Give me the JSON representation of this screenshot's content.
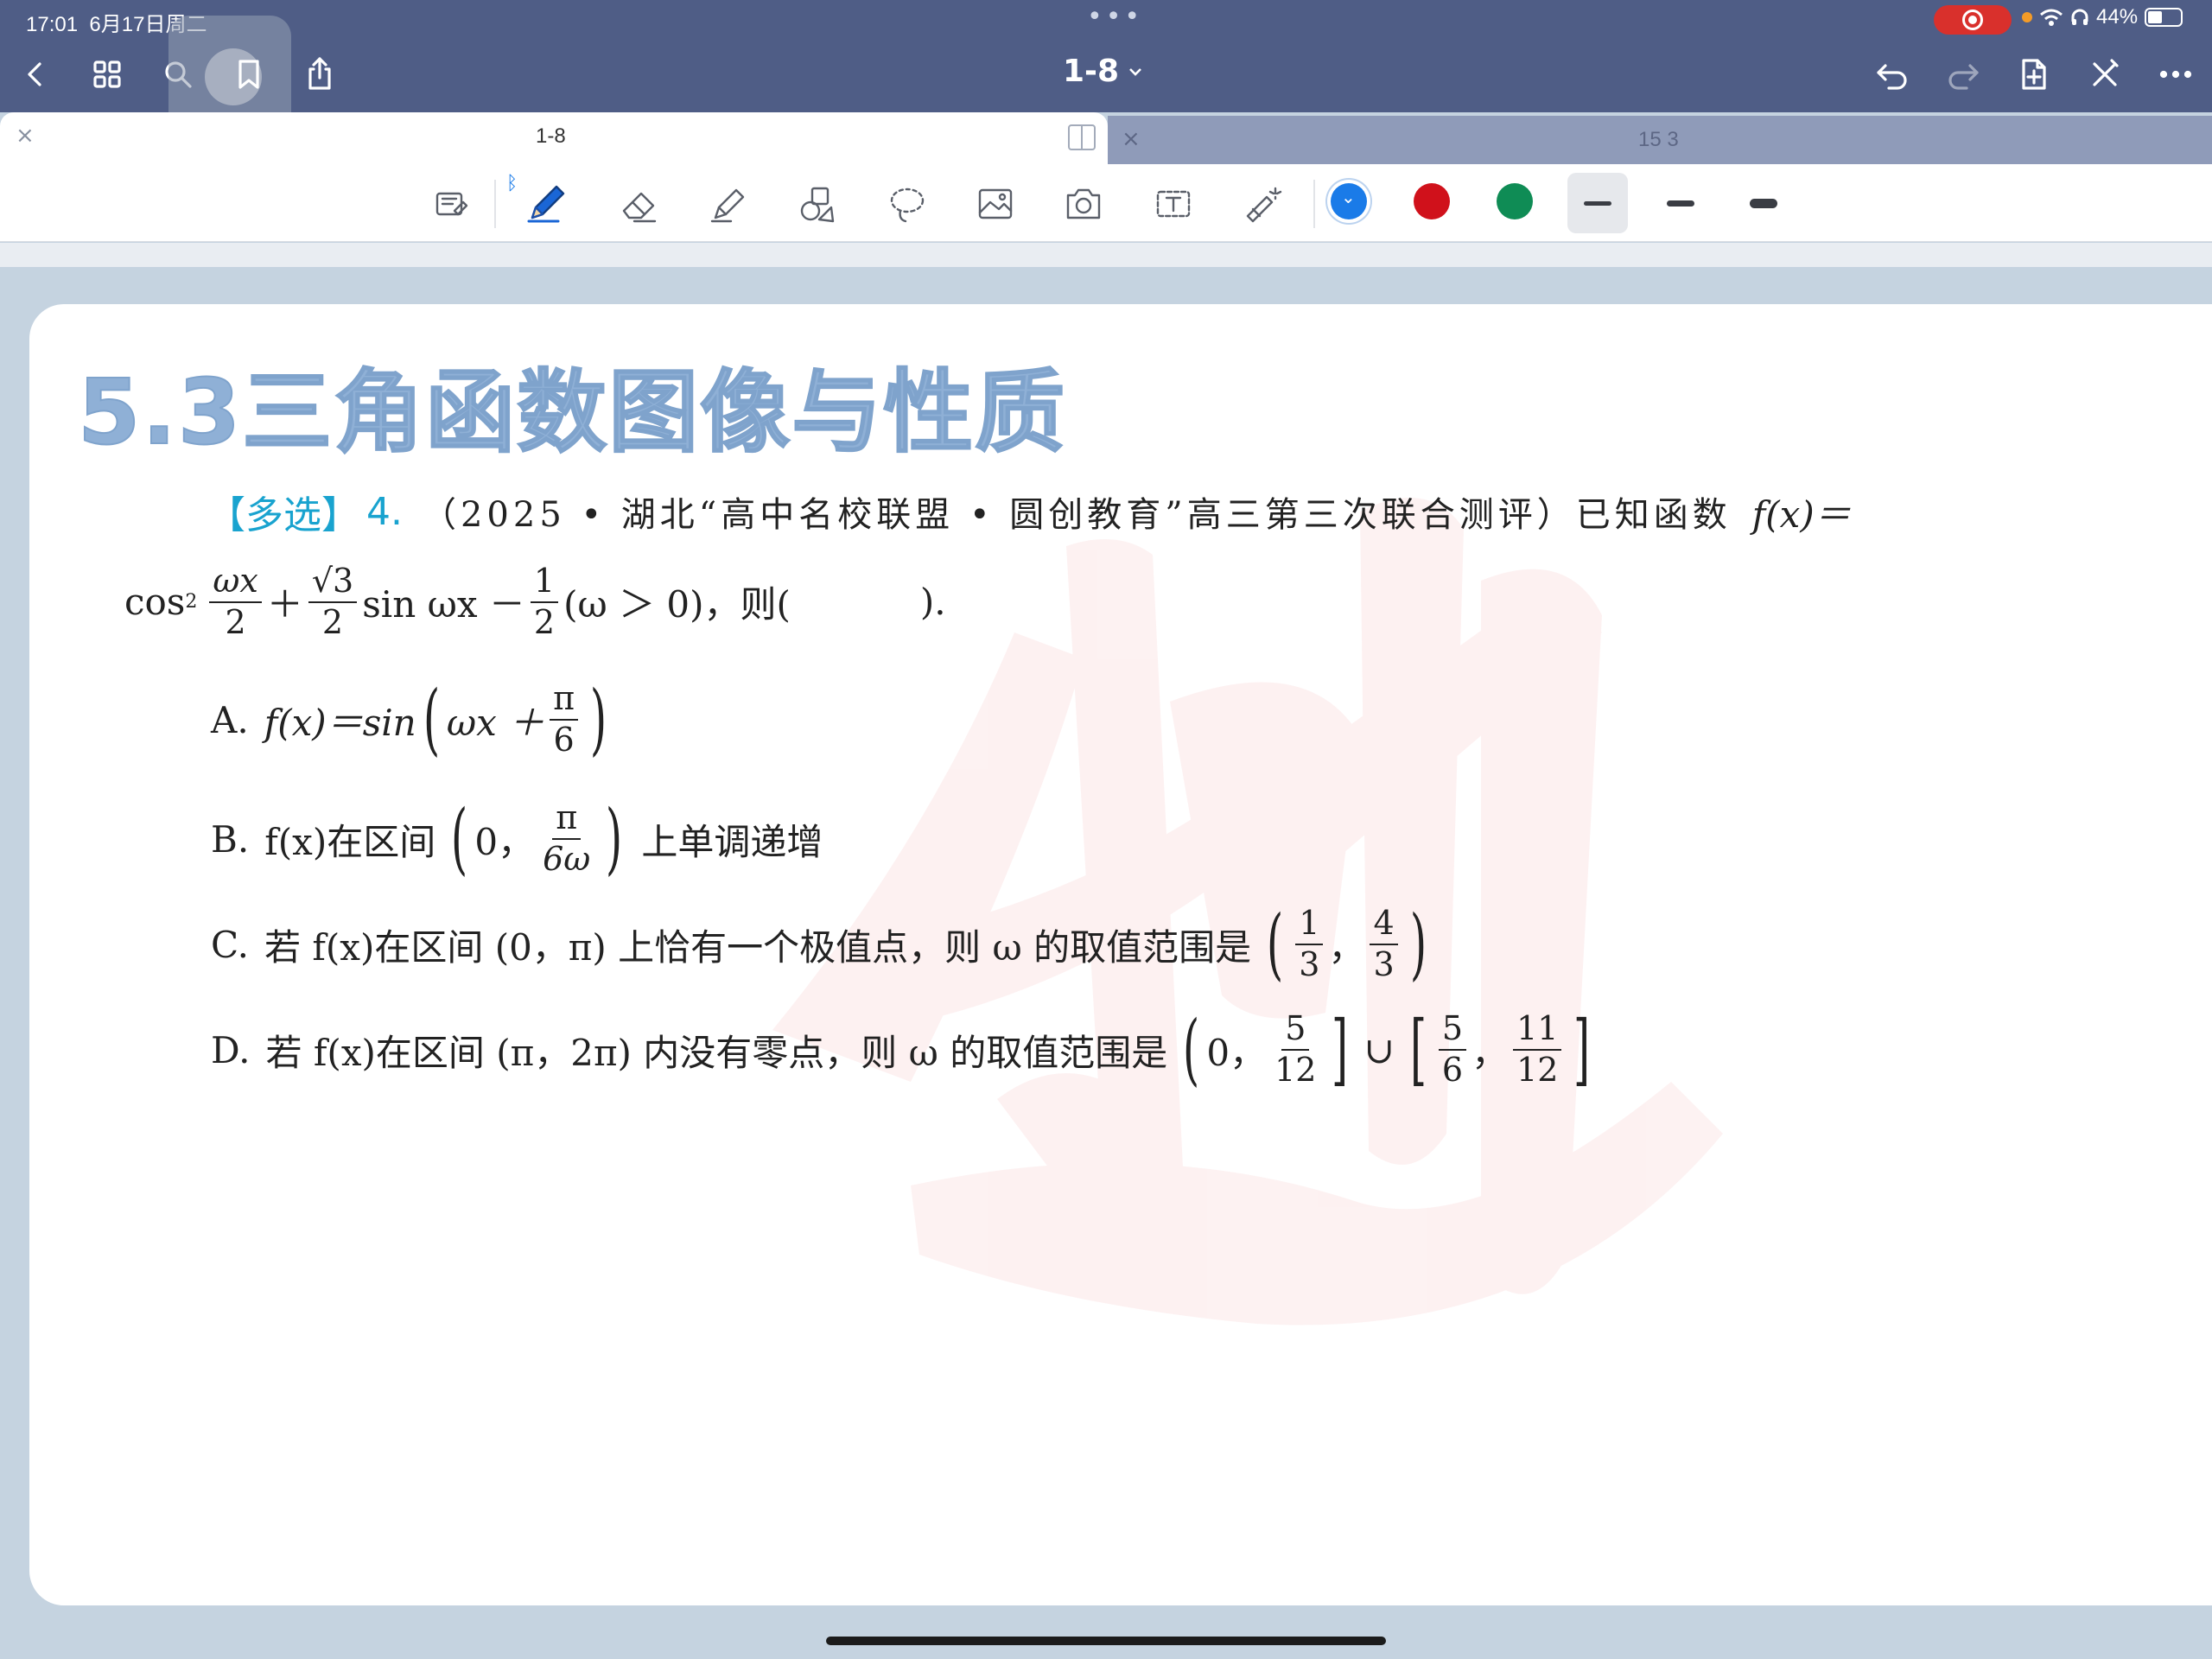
{
  "status": {
    "time": "17:01",
    "date": "6月17日周二",
    "battery": "44%",
    "dots": "•••"
  },
  "nav": {
    "title": "1-8",
    "left_icons": [
      "back-chevron-icon",
      "grid-icon",
      "search-icon",
      "bookmark-icon",
      "share-icon"
    ],
    "right_icons": [
      "undo-icon",
      "redo-icon",
      "add-page-icon",
      "close-x-icon",
      "more-icon"
    ]
  },
  "tabs": [
    {
      "label": "1-8",
      "active": true,
      "close": "×"
    },
    {
      "label": "15 3",
      "active": false,
      "close": "×"
    }
  ],
  "toolbar": {
    "tools": [
      "read-mode-icon",
      "pen-icon",
      "eraser-icon",
      "highlighter-icon",
      "shapes-icon",
      "lasso-icon",
      "image-icon",
      "camera-icon",
      "text-tool-icon",
      "laser-pointer-icon"
    ],
    "bluetooth_badge": "ᛒ",
    "colors": [
      "#1a7be8",
      "#d0111b",
      "#0f8c55"
    ],
    "selected_color_mark": "⌄",
    "thickness_levels": 3
  },
  "page": {
    "section_title": "5.3三角函数图像与性质",
    "question": {
      "tag": "【多选】",
      "number": "4.",
      "source": "（2025 • 湖北“高中名校联盟 • 圆创教育”高三第三次联合测评）已知函数",
      "f_def": "f(x)＝",
      "line2_cos": "cos",
      "line2_sq": "2",
      "line2_frac1_num": "ωx",
      "line2_frac1_den": "2",
      "line2_plus": "＋",
      "line2_frac2_num": "√3",
      "line2_frac2_den": "2",
      "line2_sin": "sin ωx －",
      "line2_frac3_num": "1",
      "line2_frac3_den": "2",
      "line2_tail": "(ω ＞ 0)，则(",
      "line2_end": ").",
      "options": {
        "A": {
          "label": "A.",
          "text": "f(x)＝sin",
          "inner": "ωx ＋",
          "frac_num": "π",
          "frac_den": "6"
        },
        "B": {
          "label": "B.",
          "text": "f(x)在区间",
          "inner": "0，",
          "frac_num": "π",
          "frac_den": "6ω",
          "tail": "上单调递增"
        },
        "C": {
          "label": "C.",
          "text": "若 f(x)在区间 (0，π) 上恰有一个极值点，则 ω 的取值范围是",
          "frac1_num": "1",
          "frac1_den": "3",
          "frac2_num": "4",
          "frac2_den": "3",
          "comma": "，"
        },
        "D": {
          "label": "D.",
          "text": "若 f(x)在区间 (π，2π) 内没有零点，则 ω 的取值范围是",
          "inner": "0，",
          "frac1_num": "5",
          "frac1_den": "12",
          "union": "∪",
          "frac2_num": "5",
          "frac2_den": "6",
          "comma": "，",
          "frac3_num": "11",
          "frac3_den": "12"
        }
      }
    }
  }
}
